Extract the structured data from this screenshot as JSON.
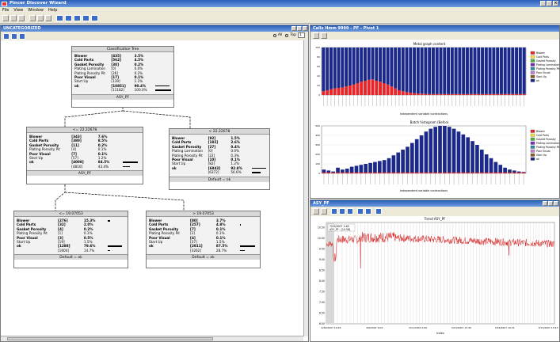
{
  "app": {
    "title": "Pincer Discover Wizard",
    "menu": [
      "File",
      "View",
      "Window",
      "Help"
    ]
  },
  "left": {
    "title": "UNCATEGORIZED",
    "all_label": "All",
    "top_label": "Top",
    "top_value": "1"
  },
  "tree": {
    "root": {
      "title": "Classification Tree",
      "footer": "ASY_PF",
      "rows": [
        {
          "n": "Blower",
          "c": "[435]",
          "p": "3.5%",
          "b": 0
        },
        {
          "n": "Cold Parts",
          "c": "[562]",
          "p": "4.5%",
          "b": 0
        },
        {
          "n": "Gasket Porosity",
          "c": "[30]",
          "p": "0.2%",
          "b": 0
        },
        {
          "n": "Plating Lamination",
          "c": "[0]",
          "p": "0.0%",
          "b": 0
        },
        {
          "n": "Plating Porosity Pit",
          "c": "[26]",
          "p": "0.2%",
          "b": 0
        },
        {
          "n": "Poor Visual",
          "c": "[17]",
          "p": "0.1%",
          "b": 0
        },
        {
          "n": "Start Up",
          "c": "[139]",
          "p": "1.1%",
          "b": 0
        },
        {
          "n": "ok",
          "c": "[10851]",
          "p": "90.4%",
          "b": 0.9
        },
        {
          "n": "",
          "c": "[11182]",
          "p": "100.0%",
          "b": 1
        }
      ]
    },
    "split1": {
      "left": "<= 22.22678",
      "right": "> 22.22678"
    },
    "n1": {
      "footer": "ASY_PF",
      "rows": [
        {
          "n": "Blower",
          "c": "[343]",
          "p": "7.6%",
          "b": 0
        },
        {
          "n": "Cold Parts",
          "c": "[380]",
          "p": "8.5%",
          "b": 0
        },
        {
          "n": "Gasket Porosity",
          "c": "[11]",
          "p": "0.2%",
          "b": 0
        },
        {
          "n": "Plating Porosity Pit",
          "c": "[4]",
          "p": "0.1%",
          "b": 0
        },
        {
          "n": "Poor Visual",
          "c": "[7]",
          "p": "0.1%",
          "b": 0
        },
        {
          "n": "Start Up",
          "c": "[57]",
          "p": "1.2%",
          "b": 0
        },
        {
          "n": "ok",
          "c": "[4008]",
          "p": "84.5%",
          "b": 0.85
        },
        {
          "n": "",
          "c": "[4810]",
          "p": "43.4%",
          "b": 0.43
        }
      ]
    },
    "n2": {
      "footer": "Default = ok",
      "rows": [
        {
          "n": "Blower",
          "c": "[92]",
          "p": "1.5%",
          "b": 0
        },
        {
          "n": "Cold Parts",
          "c": "[182]",
          "p": "2.6%",
          "b": 0
        },
        {
          "n": "Gasket Porosity",
          "c": "[27]",
          "p": "0.4%",
          "b": 0
        },
        {
          "n": "Plating Lamination",
          "c": "[0]",
          "p": "0.0%",
          "b": 0
        },
        {
          "n": "Plating Porosity Pit",
          "c": "[22]",
          "p": "0.3%",
          "b": 0
        },
        {
          "n": "Poor Visual",
          "c": "[10]",
          "p": "0.1%",
          "b": 0
        },
        {
          "n": "Start Up",
          "c": "[82]",
          "p": "1.2%",
          "b": 0
        },
        {
          "n": "ok",
          "c": "[6843]",
          "p": "92.8%",
          "b": 0.93
        },
        {
          "n": "",
          "c": "[6372]",
          "p": "56.6%",
          "b": 0.57
        }
      ]
    },
    "split2": {
      "left": "<= 19.07053",
      "right": "> 19.07053"
    },
    "n3": {
      "footer": "Default = ok",
      "rows": [
        {
          "n": "Blower",
          "c": "[276]",
          "p": "15.3%",
          "b": 0.15
        },
        {
          "n": "Cold Parts",
          "c": "[32]",
          "p": "2.0%",
          "b": 0
        },
        {
          "n": "Gasket Porosity",
          "c": "[4]",
          "p": "0.2%",
          "b": 0
        },
        {
          "n": "Plating Porosity Pit",
          "c": "[1]",
          "p": "0.1%",
          "b": 0
        },
        {
          "n": "Poor Visual",
          "c": "[3]",
          "p": "0.5%",
          "b": 0
        },
        {
          "n": "Start Up",
          "c": "[19]",
          "p": "1.5%",
          "b": 0
        },
        {
          "n": "ok",
          "c": "[1288]",
          "p": "79.6%",
          "b": 0.8
        },
        {
          "n": "",
          "c": "[1604]",
          "p": "14.7%",
          "b": 0.15
        }
      ]
    },
    "n4": {
      "footer": "Default = ok",
      "rows": [
        {
          "n": "Blower",
          "c": "[80]",
          "p": "3.7%",
          "b": 0
        },
        {
          "n": "Cold Parts",
          "c": "[257]",
          "p": "4.8%",
          "b": 0.05
        },
        {
          "n": "Gasket Porosity",
          "c": "[7]",
          "p": "0.1%",
          "b": 0
        },
        {
          "n": "Plating Porosity Pit",
          "c": "[3]",
          "p": "0.1%",
          "b": 0
        },
        {
          "n": "Poor Visual",
          "c": "[4]",
          "p": "0.1%",
          "b": 0
        },
        {
          "n": "Start Up",
          "c": "[37]",
          "p": "1.5%",
          "b": 0
        },
        {
          "n": "ok",
          "c": "[2811]",
          "p": "87.5%",
          "b": 0.87
        },
        {
          "n": "",
          "c": "[3262]",
          "p": "28.7%",
          "b": 0.29
        }
      ]
    }
  },
  "right_top": {
    "title": "Cells Hmm 9999 - PF - Pivot 1",
    "chart1_title": "Metal graph content",
    "chart2_title": "Batch histogram (Befco)",
    "xlabel": "Independent variable contractions"
  },
  "right_bottom": {
    "title": "ASY_PF",
    "chart_title": "Trend ASY_PF",
    "xlabel": "Index",
    "readout1": "7/25/2007 1:48",
    "readout2": "ASY_PF : [10.58]"
  },
  "colors": {
    "Blower": "#e8262a",
    "Cold Parts": "#f5e23a",
    "Gasket Porosity": "#4caf40",
    "Plating Lamination": "#7a2bc4",
    "Plating Porosity Pit": "#2b8c9e",
    "Poor Visual": "#c27ed6",
    "Start Up": "#8b5a2b",
    "ok": "#1b2a8a",
    "trend": "#d42020"
  },
  "chart_data": [
    {
      "type": "bar",
      "title": "Metal graph content",
      "xlabel": "Independent variable contractions",
      "ylim": [
        0,
        100
      ],
      "series": [
        {
          "name": "Blower",
          "values": [
            8,
            10,
            12,
            14,
            15,
            16,
            18,
            20,
            22,
            25,
            28,
            30,
            32,
            33,
            30,
            28,
            25,
            22,
            18,
            14,
            10,
            8,
            6,
            5,
            4,
            3,
            3,
            2,
            2,
            2,
            2,
            2,
            2,
            2,
            2,
            2,
            2,
            2,
            2,
            2,
            2,
            2,
            2,
            2,
            2,
            2,
            2,
            2,
            2,
            2,
            2,
            2,
            2,
            2
          ]
        },
        {
          "name": "ok",
          "values": [
            92,
            90,
            88,
            86,
            85,
            84,
            82,
            80,
            78,
            75,
            72,
            70,
            68,
            67,
            70,
            72,
            75,
            78,
            82,
            86,
            90,
            92,
            94,
            95,
            96,
            97,
            97,
            98,
            98,
            98,
            98,
            98,
            98,
            98,
            98,
            98,
            98,
            98,
            98,
            98,
            98,
            98,
            98,
            98,
            98,
            98,
            98,
            98,
            98,
            98,
            98,
            98,
            98,
            98
          ]
        }
      ],
      "legend": [
        "Blower",
        "Cold Parts",
        "Gasket Porosity",
        "Plating Lamination",
        "Plating Porosity Pit",
        "Poor Visual",
        "Start Up",
        "ok"
      ]
    },
    {
      "type": "bar",
      "title": "Batch histogram (Befco)",
      "xlabel": "Independent variable contractions",
      "ylim": [
        0,
        500
      ],
      "series": [
        {
          "name": "ok",
          "values": [
            40,
            30,
            20,
            60,
            40,
            50,
            70,
            80,
            90,
            100,
            110,
            120,
            130,
            140,
            160,
            190,
            220,
            250,
            280,
            320,
            360,
            400,
            440,
            470,
            490,
            500,
            500,
            490,
            470,
            440,
            410,
            380,
            340,
            300,
            250,
            200,
            160,
            120,
            90,
            60,
            40,
            30,
            20,
            15
          ]
        }
      ],
      "legend": [
        "Blower",
        "Cold Parts",
        "Gasket Porosity",
        "Plating Lamination",
        "Plating Porosity Pit",
        "Poor Visual",
        "Start Up",
        "ok"
      ]
    },
    {
      "type": "line",
      "title": "Trend ASY_PF",
      "xlabel": "Index",
      "x_ticks": [
        "2/26/2007 19:45",
        "3/6/2007 9:02",
        "3/11/2007 0:00",
        "3/13/2007 13:30",
        "3/16/2007 19:21",
        "3/17/2007 13:43"
      ],
      "y_ticks": [
        "10.50",
        "10.00",
        "9.50",
        "9.00",
        "8.50",
        "8.00",
        "7.50",
        "7.00",
        "6.50",
        "6.00"
      ],
      "ylim": [
        6,
        10.75
      ]
    }
  ]
}
